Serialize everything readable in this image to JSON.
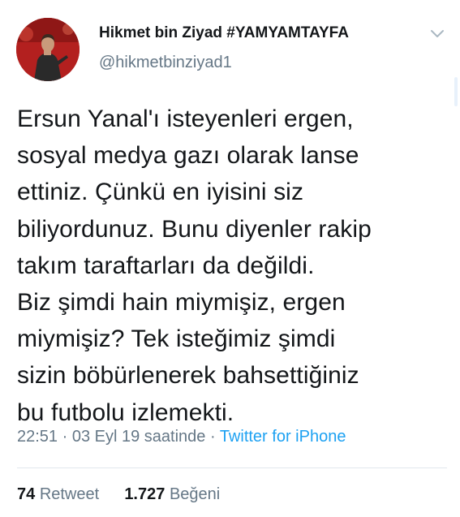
{
  "user": {
    "name": "Hikmet bin Ziyad #YAMYAMTAYFA",
    "handle": "@hikmetbinziyad1"
  },
  "tweet": {
    "lines": [
      "Ersun Yanal'ı isteyenleri ergen,",
      "sosyal medya gazı olarak lanse",
      "ettiniz. Çünkü en iyisini siz",
      "biliyordunuz. Bunu diyenler rakip",
      "takım taraftarları da değildi.",
      "Biz şimdi hain miymişiz, ergen",
      "miymişiz? Tek isteğimiz şimdi",
      "sizin böbürlenerek bahsettiğiniz",
      "bu futbolu izlemekti."
    ],
    "timestamp": "22:51 · 03 Eyl 19 saatinde ·",
    "source": "Twitter for iPhone"
  },
  "stats": {
    "retweet_count": "74",
    "retweet_label": "Retweet",
    "like_count": "1.727",
    "like_label": "Beğeni"
  },
  "icons": {
    "menu": "chevron-down-icon"
  },
  "colors": {
    "text": "#14171a",
    "secondary": "#657786",
    "link": "#1da1f2",
    "divider": "#e1e8ed",
    "avatar_bg": "#b3201f"
  }
}
